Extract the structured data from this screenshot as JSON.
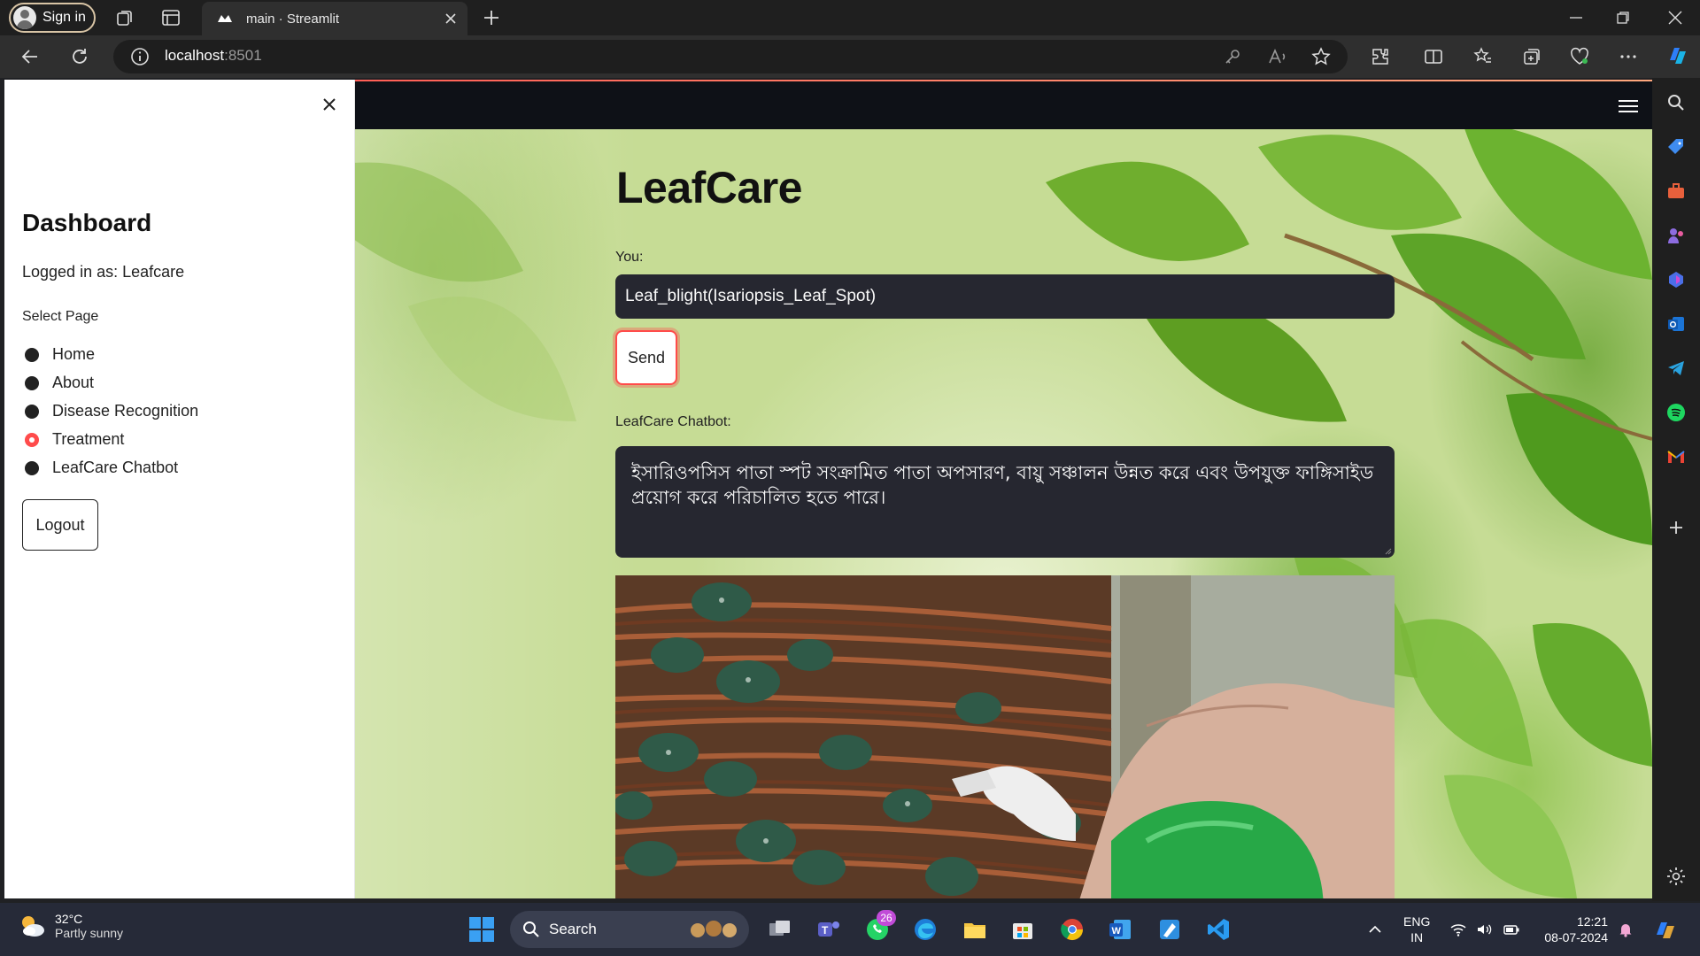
{
  "browser": {
    "signin_label": "Sign in",
    "tab_title": "main · Streamlit",
    "url_host": "localhost",
    "url_port": ":8501"
  },
  "sidebar": {
    "title": "Dashboard",
    "logged_in": "Logged in as: Leafcare",
    "select_label": "Select Page",
    "pages": [
      "Home",
      "About",
      "Disease Recognition",
      "Treatment",
      "LeafCare Chatbot"
    ],
    "selected": "Treatment",
    "logout_label": "Logout"
  },
  "main": {
    "title": "LeafCare",
    "you_label": "You:",
    "input_value": "Leaf_blight(Isariopsis_Leaf_Spot)",
    "send_label": "Send",
    "bot_label": "LeafCare Chatbot:",
    "bot_answer": "ইসারিওপসিস পাতা স্পট সংক্রামিত পাতা অপসারণ, বায়ু সঞ্চালন উন্নত করে এবং উপযুক্ত ফাঙ্গিসাইড প্রয়োগ করে পরিচালিত হতে পারে।"
  },
  "taskbar": {
    "weather_temp": "32°C",
    "weather_desc": "Partly sunny",
    "search_label": "Search",
    "whatsapp_badge": "26",
    "lang_top": "ENG",
    "lang_bottom": "IN",
    "time": "12:21",
    "date": "08-07-2024"
  },
  "colors": {
    "accent": "#ff4b4b",
    "input_bg": "#262730",
    "header_bg": "#0e1117"
  }
}
